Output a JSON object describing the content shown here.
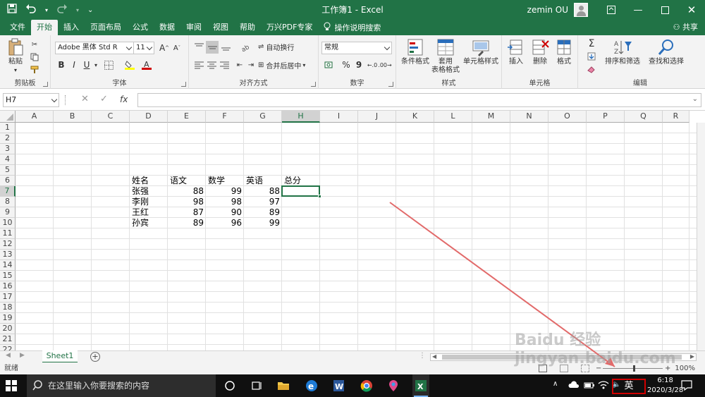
{
  "window": {
    "title": "工作簿1 - Excel",
    "user": "zemin OU"
  },
  "ribbon_tabs": [
    {
      "label": "文件"
    },
    {
      "label": "开始"
    },
    {
      "label": "插入"
    },
    {
      "label": "页面布局"
    },
    {
      "label": "公式"
    },
    {
      "label": "数据"
    },
    {
      "label": "审阅"
    },
    {
      "label": "视图"
    },
    {
      "label": "帮助"
    },
    {
      "label": "万兴PDF专家"
    }
  ],
  "help_search": "操作说明搜索",
  "share": "共享",
  "ribbon": {
    "clipboard": {
      "paste": "粘贴",
      "label": "剪贴板"
    },
    "font": {
      "name": "Adobe 黑体 Std R",
      "size": "11",
      "label": "字体",
      "bold": "B",
      "italic": "I",
      "underline": "U",
      "grow": "A",
      "shrink": "A"
    },
    "alignment": {
      "wrap": "自动换行",
      "merge": "合并后居中",
      "label": "对齐方式"
    },
    "number": {
      "format": "常规",
      "percent": "%",
      "comma": "9",
      "label": "数字"
    },
    "styles": {
      "conditional": "条件格式",
      "table_l1": "套用",
      "table_l2": "表格格式",
      "cell_styles": "单元格样式",
      "label": "样式"
    },
    "cells": {
      "insert": "插入",
      "delete": "删除",
      "format": "格式",
      "label": "单元格"
    },
    "editing": {
      "sigma": "Σ",
      "sort": "排序和筛选",
      "find": "查找和选择",
      "label": "编辑"
    }
  },
  "formula_bar": {
    "name_box": "H7",
    "fx": "fx",
    "value": ""
  },
  "columns": [
    "A",
    "B",
    "C",
    "D",
    "E",
    "F",
    "G",
    "H",
    "I",
    "J",
    "K",
    "L",
    "M",
    "N",
    "O",
    "P",
    "Q",
    "R"
  ],
  "rows": [
    "1",
    "2",
    "3",
    "4",
    "5",
    "6",
    "7",
    "8",
    "9",
    "10",
    "11",
    "12",
    "13",
    "14",
    "15",
    "16",
    "17",
    "18",
    "19",
    "20",
    "21",
    "22"
  ],
  "selected_cell": {
    "col": "H",
    "row": "7"
  },
  "cells": {
    "header": [
      "姓名",
      "语文",
      "数学",
      "英语",
      "总分"
    ],
    "rows": [
      [
        "张强",
        "88",
        "99",
        "88"
      ],
      [
        "李刚",
        "98",
        "98",
        "97"
      ],
      [
        "王红",
        "87",
        "90",
        "89"
      ],
      [
        "孙宾",
        "89",
        "96",
        "99"
      ]
    ]
  },
  "sheet_tabs": [
    {
      "label": "Sheet1"
    }
  ],
  "status": {
    "text": "就绪",
    "zoom": "100%"
  },
  "taskbar": {
    "search_placeholder": "在这里输入你要搜索的内容",
    "ime": "英",
    "time": "6:18",
    "date": "2020/3/28"
  },
  "watermark": "Baidu 经验 jingyan.baidu.com",
  "colors": {
    "excel_green": "#217346",
    "highlight_red": "#d00000"
  }
}
